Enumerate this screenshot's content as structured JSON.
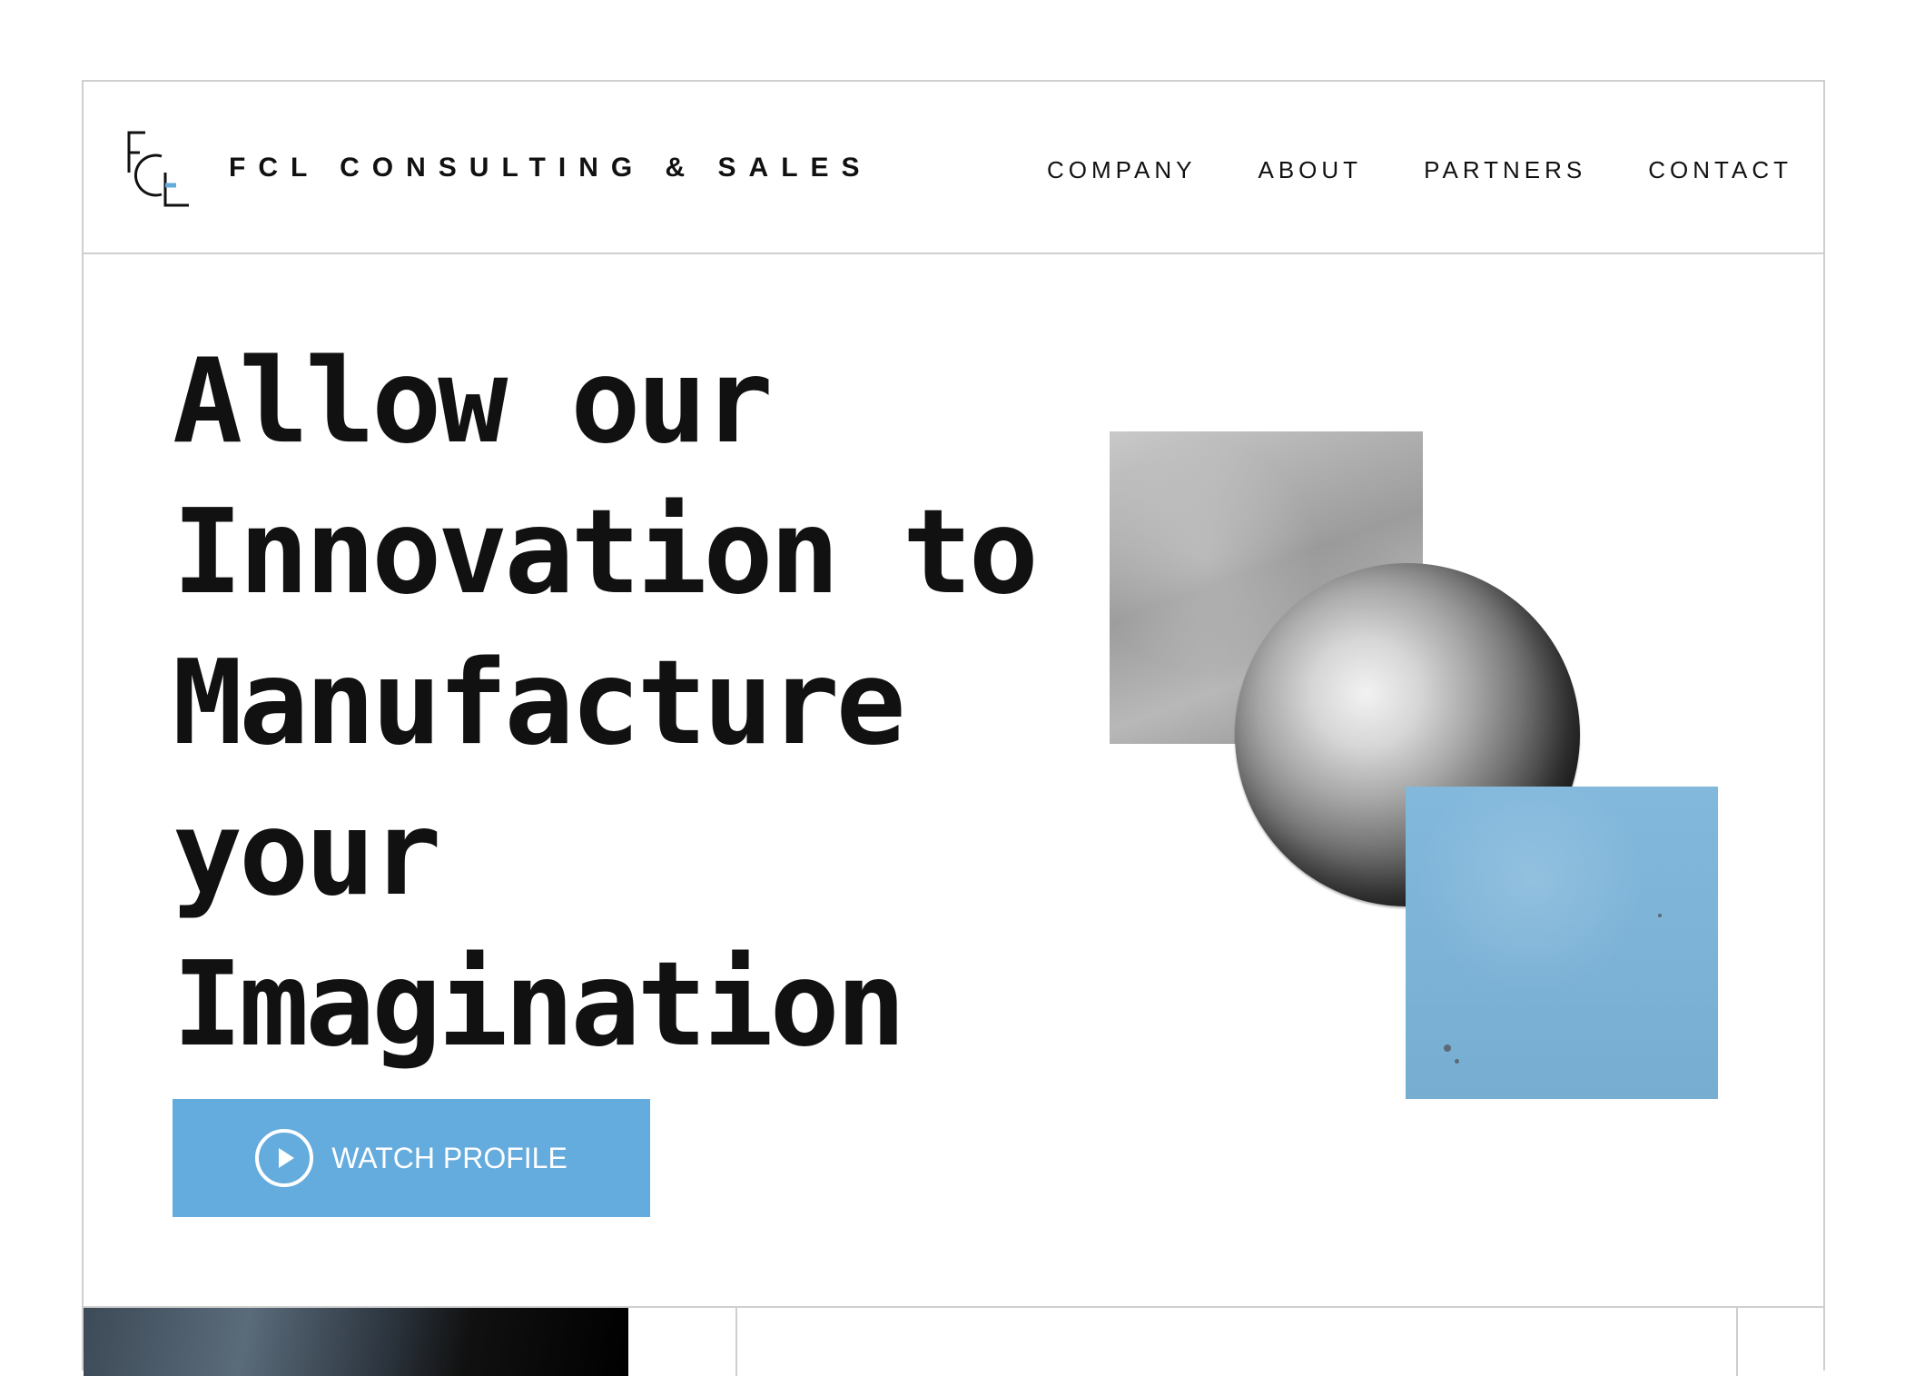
{
  "header": {
    "brand": "FCL CONSULTING & SALES",
    "nav": [
      "COMPANY",
      "ABOUT",
      "PARTNERS",
      "CONTACT"
    ]
  },
  "hero": {
    "title_lines": [
      "Allow our",
      "Innovation to",
      "Manufacture",
      "your",
      "Imagination"
    ],
    "cta_label": "WATCH PROFILE"
  },
  "colors": {
    "accent": "#64abde",
    "text": "#111111",
    "border": "#cfcfcf"
  },
  "icons": {
    "cta": "play-circle-icon",
    "logo": "fcl-logo-icon"
  }
}
